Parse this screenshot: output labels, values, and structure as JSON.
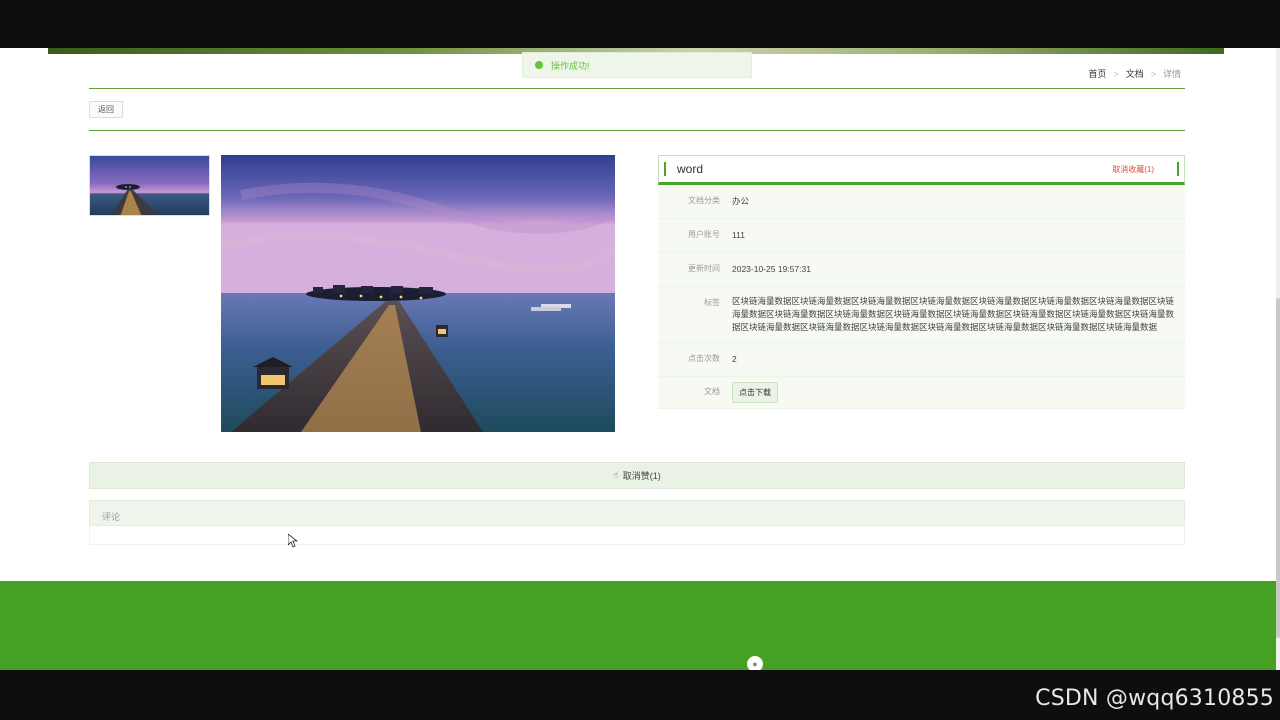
{
  "toast": {
    "text": "操作成功!"
  },
  "breadcrumb": {
    "home": "首页",
    "section": "文档",
    "current": "详情",
    "separator": ">"
  },
  "back_button": "返回",
  "detail": {
    "title": "word",
    "favorite_action": "取消收藏(1)",
    "rows": {
      "category": {
        "label": "文档分类",
        "value": "办公"
      },
      "account": {
        "label": "用户账号",
        "value": "111"
      },
      "updated": {
        "label": "更新时间",
        "value": "2023-10-25 19:57:31"
      },
      "tags": {
        "label": "标签",
        "value": "区块链海量数据区块链海量数据区块链海量数据区块链海量数据区块链海量数据区块链海量数据区块链海量数据区块链海量数据区块链海量数据区块链海量数据区块链海量数据区块链海量数据区块链海量数据区块链海量数据区块链海量数据区块链海量数据区块链海量数据区块链海量数据区块链海量数据区块链海量数据区块链海量数据区块链海量数据"
      },
      "clicks": {
        "label": "点击次数",
        "value": "2"
      },
      "document": {
        "label": "文档",
        "button": "点击下载"
      }
    }
  },
  "like_bar": {
    "icon": "thumb-up-icon",
    "text": "取消赞(1)"
  },
  "comments": {
    "header": "评论"
  },
  "watermark": "CSDN @wqq6310855",
  "colors": {
    "accent": "#4aa52b",
    "footer": "#46a023",
    "danger": "#e04a3b"
  }
}
